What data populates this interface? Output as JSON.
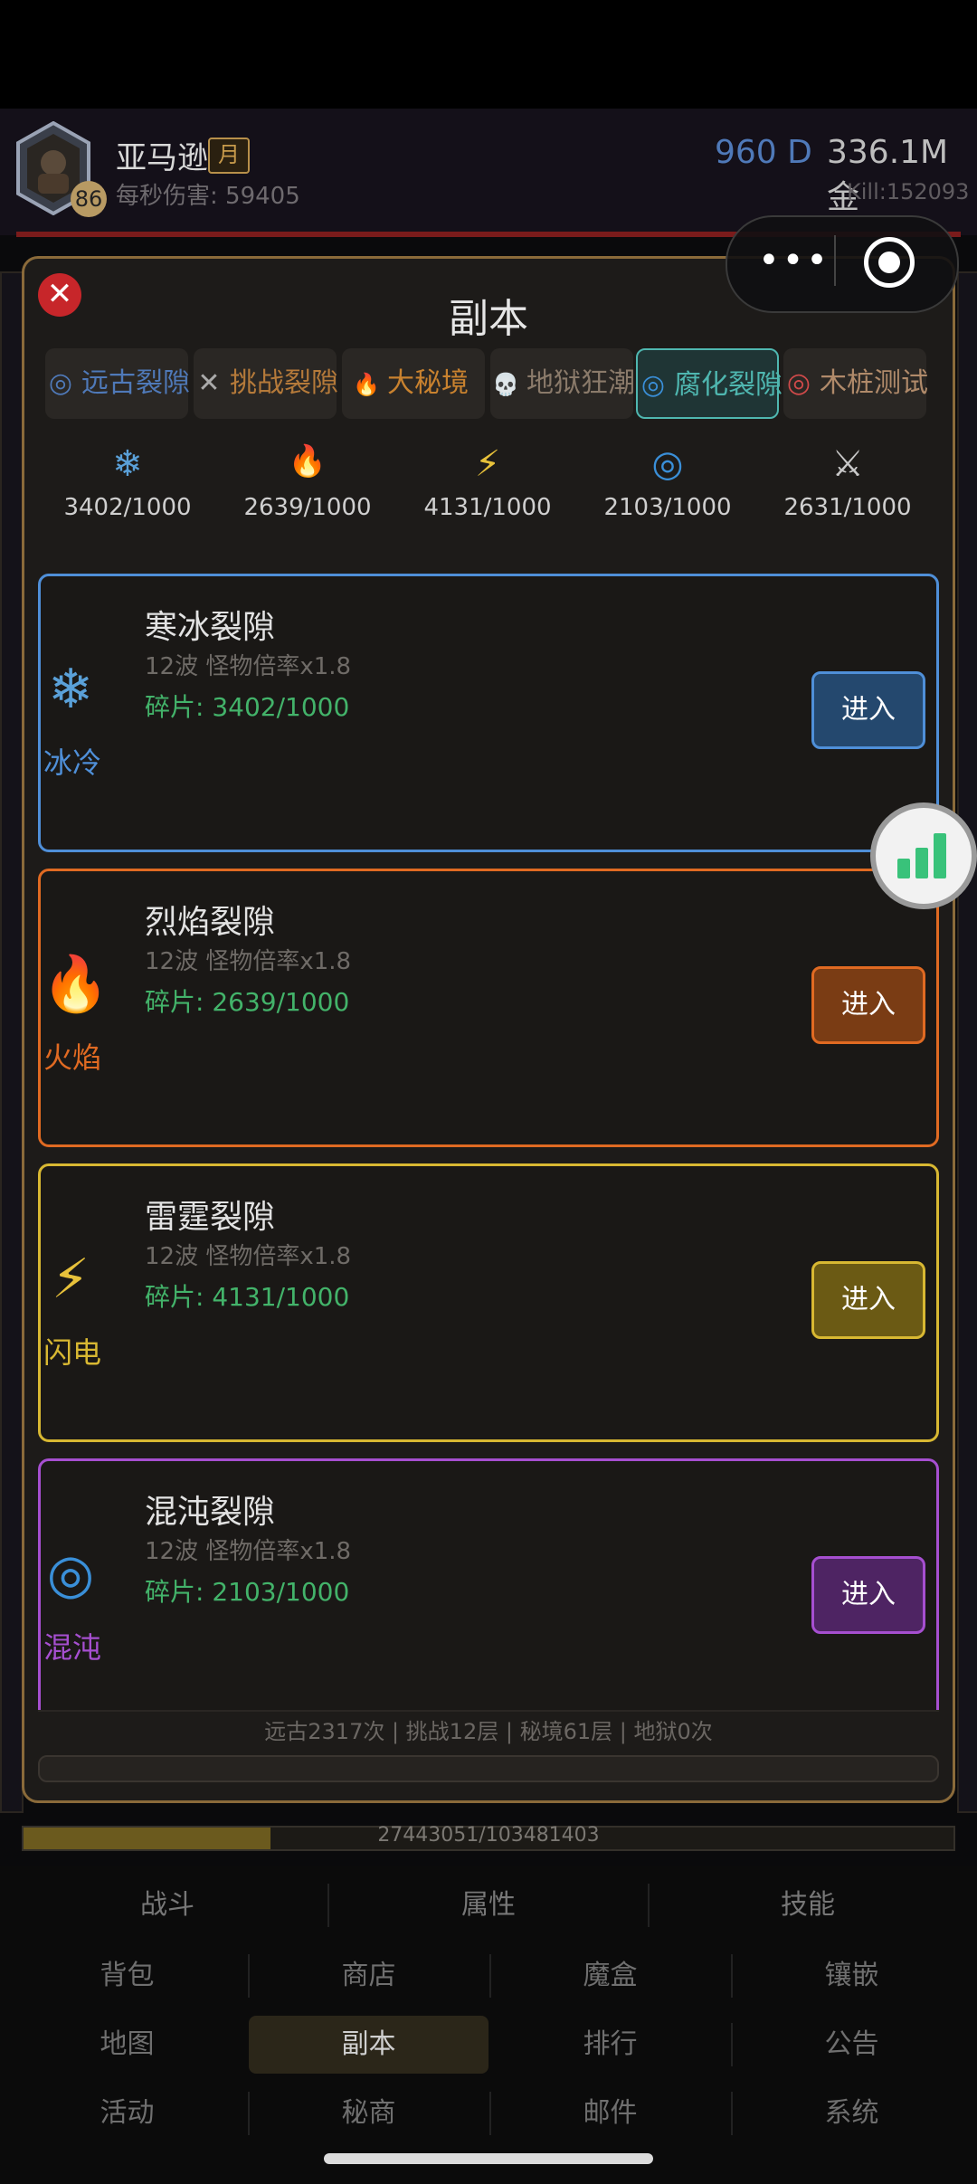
{
  "player": {
    "name": "亚马逊",
    "badge": "月",
    "level": "86",
    "dps": "每秒伤害: 59405",
    "diamonds": "960 D",
    "gold": "336.1M 金",
    "kills": "Kill:152093"
  },
  "dialog": {
    "title": "副本",
    "tabs": [
      {
        "icon": "◎",
        "label": "远古裂隙",
        "color": "#4f79b8"
      },
      {
        "icon": "✕",
        "label": "挑战裂隙",
        "color": "#b57a3a"
      },
      {
        "icon": "🔥",
        "label": "大秘境",
        "color": "#c9822f"
      },
      {
        "icon": "💀",
        "label": "地狱狂潮",
        "color": "#8a7a6a"
      },
      {
        "icon": "◎",
        "label": "腐化裂隙",
        "color": "#4fb7b0"
      },
      {
        "icon": "◎",
        "label": "木桩测试",
        "color": "#b08a6a"
      }
    ],
    "resources": [
      {
        "icon": "❄",
        "value": "3402/1000",
        "color": "#5aa0d8"
      },
      {
        "icon": "🔥",
        "value": "2639/1000",
        "color": "#e07b2a"
      },
      {
        "icon": "⚡",
        "value": "4131/1000",
        "color": "#e7c13a"
      },
      {
        "icon": "◎",
        "value": "2103/1000",
        "color": "#3a8fd8"
      },
      {
        "icon": "⚔",
        "value": "2631/1000",
        "color": "#c8c8c8"
      }
    ],
    "rifts": [
      {
        "icon": "❄",
        "element": "冰冷",
        "name": "寒冰裂隙",
        "info": "12波   怪物倍率x1.8",
        "fragments": "碎片: 3402/1000",
        "enter": "进入",
        "color": "#4f8fd8",
        "btn_bg": "#24486e"
      },
      {
        "icon": "🔥",
        "element": "火焰",
        "name": "烈焰裂隙",
        "info": "12波   怪物倍率x1.8",
        "fragments": "碎片: 2639/1000",
        "enter": "进入",
        "color": "#e06a22",
        "btn_bg": "#7a3c14"
      },
      {
        "icon": "⚡",
        "element": "闪电",
        "name": "雷霆裂隙",
        "info": "12波   怪物倍率x1.8",
        "fragments": "碎片: 4131/1000",
        "enter": "进入",
        "color": "#d8b832",
        "btn_bg": "#6b5a14"
      },
      {
        "icon": "◎",
        "element": "混沌",
        "name": "混沌裂隙",
        "info": "12波   怪物倍率x1.8",
        "fragments": "碎片: 2103/1000",
        "enter": "进入",
        "color": "#a64fd0",
        "btn_bg": "#4e2463"
      }
    ],
    "footer": "远古2317次 | 挑战12层 | 秘境61层 | 地狱0次"
  },
  "progress": {
    "text": "27443051/103481403",
    "fraction": 0.2652
  },
  "nav": {
    "row1": [
      "战斗",
      "属性",
      "技能"
    ],
    "row2": [
      "背包",
      "商店",
      "魔盒",
      "镶嵌"
    ],
    "row3": [
      "地图",
      "副本",
      "排行",
      "公告"
    ],
    "row4": [
      "活动",
      "秘商",
      "邮件",
      "系统"
    ],
    "selected": "副本"
  }
}
